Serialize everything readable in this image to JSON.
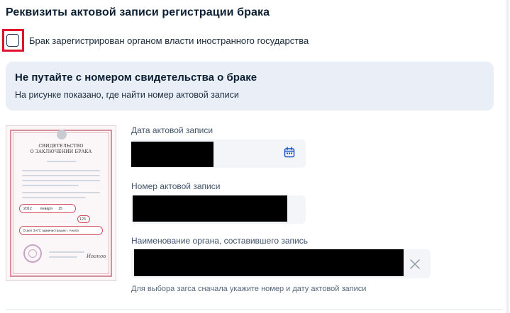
{
  "section": {
    "title": "Реквизиты актовой записи регистрации брака",
    "foreign_checkbox_label": "Брак зарегистрирован органом власти иностранного государства",
    "foreign_checkbox_checked": false
  },
  "info": {
    "title": "Не путайте с номером свидетельства о браке",
    "text": "На рисунке показано, где найти номер актовой записи"
  },
  "certificate": {
    "title_line1": "СВИДЕТЕЛЬСТВО",
    "title_line2": "О ЗАКЛЮЧЕНИИ БРАКА",
    "year": "2012",
    "month": "января",
    "day": "15",
    "record_number": "123",
    "office": "Отдел ЗАГС администрации г. Анапа",
    "signature": "Иванов"
  },
  "fields": {
    "date": {
      "label": "Дата актовой записи",
      "value": ""
    },
    "number": {
      "label": "Номер актовой записи",
      "value": ""
    },
    "office": {
      "label": "Наименование органа, составившего запись",
      "value": ""
    }
  },
  "hint": "Для выбора загса сначала укажите номер и дату актовой записи",
  "colors": {
    "highlight": "#e0112b",
    "info_bg": "#e9eef7",
    "accent": "#0d4cd3"
  },
  "icons": {
    "date": "calendar-icon",
    "office_clear": "close-icon"
  }
}
